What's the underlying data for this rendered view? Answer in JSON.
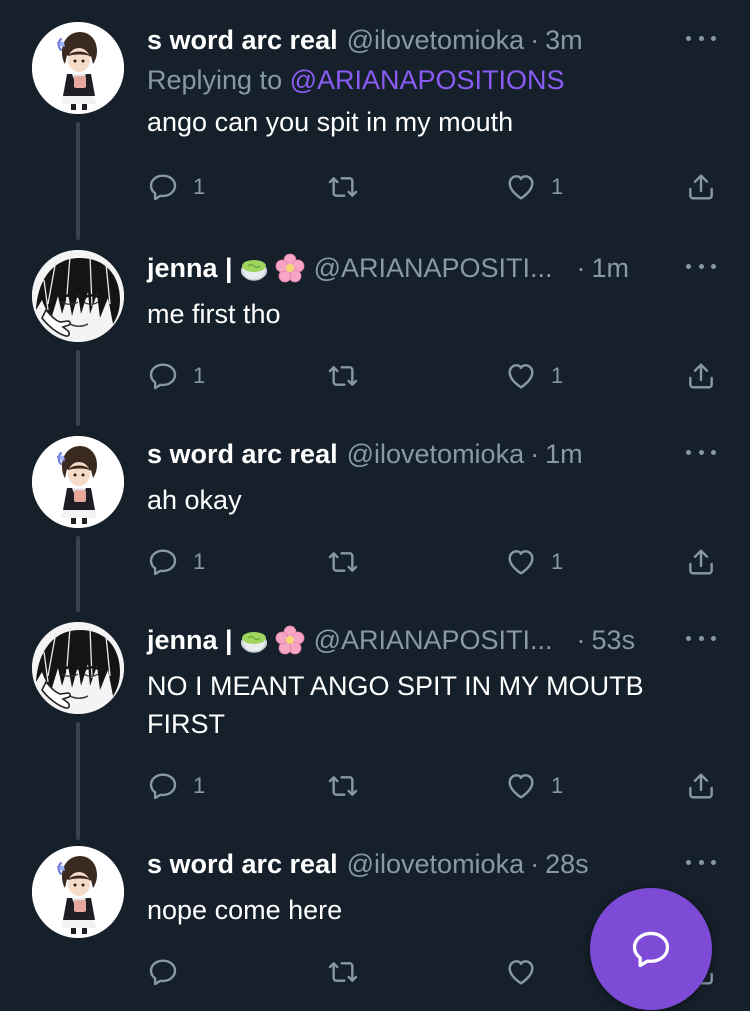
{
  "tweets": [
    {
      "name": "s word arc real",
      "handle": "@ilovetomioka",
      "dot": "·",
      "time": "3m",
      "replying_prefix": "Replying to ",
      "replying_mention": "@ARIANAPOSITIONS",
      "text": "ango can you spit in my mouth",
      "replies": "1",
      "likes": "1"
    },
    {
      "name": "jenna |",
      "handle": "@ARIANAPOSITI...",
      "dot": "·",
      "time": "1m",
      "text": "me first tho",
      "replies": "1",
      "likes": "1"
    },
    {
      "name": "s word arc real",
      "handle": "@ilovetomioka",
      "dot": "·",
      "time": "1m",
      "text": "ah okay",
      "replies": "1",
      "likes": "1"
    },
    {
      "name": "jenna |",
      "handle": "@ARIANAPOSITI...",
      "dot": "·",
      "time": "53s",
      "text_line1": "NO I MEANT ANGO SPIT IN MY MOUTB",
      "text_line2": "FIRST",
      "replies": "1",
      "likes": "1"
    },
    {
      "name": "s word arc real",
      "handle": "@ilovetomioka",
      "dot": "·",
      "time": "28s",
      "text": "nope come here"
    }
  ],
  "icons": {
    "reply": "reply-icon",
    "retweet": "retweet-icon",
    "like": "heart-icon",
    "share": "share-icon",
    "more": "more-icon",
    "compose": "compose-reply-icon"
  },
  "colors": {
    "background": "#15202b",
    "secondary_text": "#8899a6",
    "mention": "#8a5cf5",
    "fab": "#7e4bd6"
  }
}
